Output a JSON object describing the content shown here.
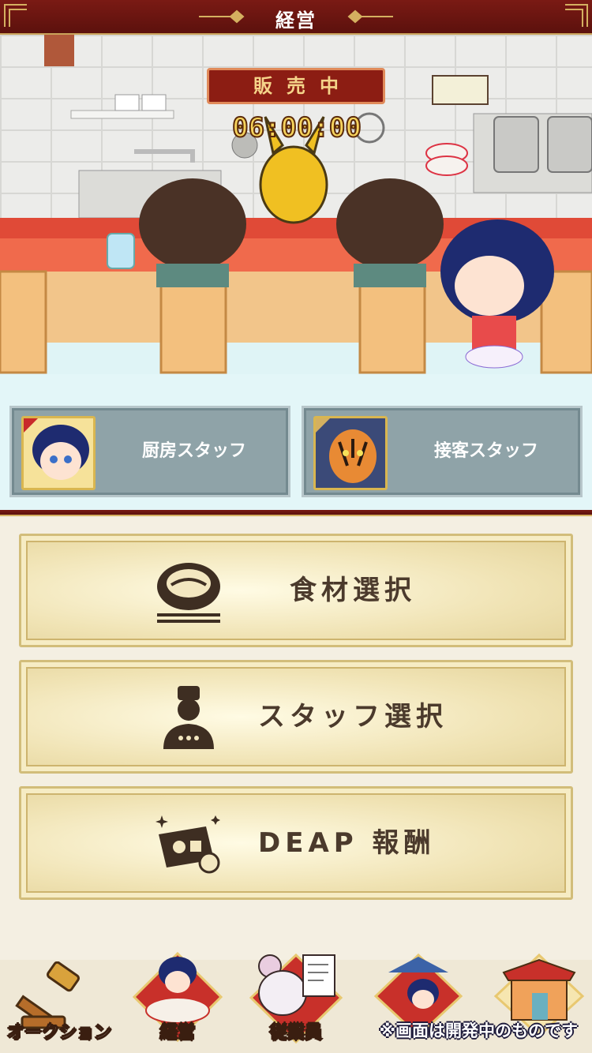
{
  "header": {
    "title": "経営"
  },
  "shop": {
    "status_badge": "販売中",
    "timer": "06:00:00"
  },
  "staff": {
    "kitchen_label": "厨房スタッフ",
    "service_label": "接客スタッフ"
  },
  "menu": {
    "ingredients_label": "食材選択",
    "staff_select_label": "スタッフ選択",
    "reward_label": "DEAP 報酬"
  },
  "nav": {
    "items": [
      {
        "label": "オークション"
      },
      {
        "label": "経営"
      },
      {
        "label": "従業員"
      },
      {
        "label": ""
      },
      {
        "label": ""
      }
    ],
    "notice": "※画面は開発中のものです"
  },
  "colors": {
    "header_red": "#6a1510",
    "gold": "#f6d35c",
    "panel_bg": "#e3f6f8"
  }
}
